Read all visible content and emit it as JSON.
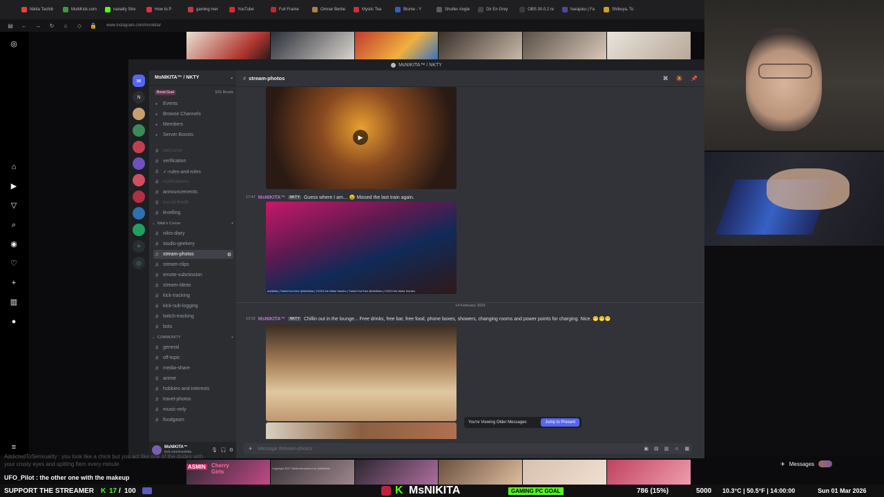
{
  "browser": {
    "tabs": [
      "Nikita Tachib",
      "MultiKick.com",
      "nanatty Stre",
      "How to P",
      "gaming mer",
      "YouTube",
      "Full Frame",
      "Omnar Berbe",
      "Mystic Tea",
      "Blume - Y",
      "Shutter Angle",
      "Dir En Grey",
      "OBS 30.0.2 re",
      "harajuku | Fa",
      "Shibuya, To"
    ],
    "url": "www.instagram.com/msnikita/"
  },
  "discord": {
    "window_title": "MsNIKITA™ / NKTY",
    "server_name": "MsNIKITA™ / NKTY",
    "boost_goal": "Boost Goal",
    "boost_count": "5/31 Boosts",
    "guild_top_label": "N",
    "menu": [
      {
        "label": "Events",
        "icon": "calendar-icon"
      },
      {
        "label": "Browse Channels",
        "icon": "browse-icon"
      },
      {
        "label": "Members",
        "icon": "members-icon"
      },
      {
        "label": "Server Boosts",
        "icon": "boost-icon"
      }
    ],
    "channels_top": [
      {
        "label": "welcome",
        "state": "muted"
      },
      {
        "label": "verification",
        "state": "normal"
      },
      {
        "label": "✓-rules-and-roles",
        "state": "normal"
      },
      {
        "label": "notifications",
        "state": "muted"
      },
      {
        "label": "announcements",
        "state": "normal"
      },
      {
        "label": "social-feeds",
        "state": "muted"
      },
      {
        "label": "levelling",
        "state": "normal"
      }
    ],
    "category_nikki": "Nikki's Corner",
    "channels_nikki": [
      {
        "label": "nikis-diary",
        "state": "normal"
      },
      {
        "label": "studio-geekery",
        "state": "normal"
      },
      {
        "label": "stream-photos",
        "state": "active"
      },
      {
        "label": "stream-clips",
        "state": "normal"
      },
      {
        "label": "emote-submission",
        "state": "normal"
      },
      {
        "label": "stream-ideas",
        "state": "normal"
      },
      {
        "label": "kick-tracking",
        "state": "normal"
      },
      {
        "label": "kick-sub-logging",
        "state": "normal"
      },
      {
        "label": "twitch-tracking",
        "state": "normal"
      },
      {
        "label": "bots",
        "state": "normal"
      }
    ],
    "category_community": "COMMUNITY",
    "channels_community": [
      {
        "label": "general",
        "state": "normal"
      },
      {
        "label": "off-topic",
        "state": "normal"
      },
      {
        "label": "media-share",
        "state": "normal"
      },
      {
        "label": "anime",
        "state": "normal"
      },
      {
        "label": "hobbies-and-interests",
        "state": "normal"
      },
      {
        "label": "travel-photos",
        "state": "normal"
      },
      {
        "label": "music-only",
        "state": "normal"
      },
      {
        "label": "foodgasm",
        "state": "normal"
      }
    ],
    "user_name": "MsNIKITA™",
    "user_sub": "kick.com/msnikita",
    "current_channel": "stream-photos",
    "messages": [
      {
        "time": "17:47",
        "user": "MsNIKITA™",
        "tag": "NKTY",
        "text": "Guess where I am… 😀 Missed the last train again."
      },
      {
        "time": "13:32",
        "user": "MsNIKITA™",
        "tag": "NKTY",
        "text": "Chillin out in the lounge... Free drinks, free bar, free food, phone boxes, showers, changing rooms and power points for charging. Nice. 😁😁😁"
      }
    ],
    "photo_caption": "msNikita | Twitch/YouTube @MsNikita | ©2023 Ms Nikita Tachibo | Twitch/YouTube @MsNikita | ©2023 Ms Nikita Tachibo",
    "date_divider": "14 February 2023",
    "older_notice": "You're Viewing Older Messages",
    "jump_label": "Jump to Present",
    "composer_placeholder": "Message #stream-photos"
  },
  "overlay": {
    "chat_line_1": "AddictedToSensuality : you look like a chick but you act like one of the dudes with your crusty eyes and spitting flem every minute",
    "chat_line_2": "UFO_Pilot : the other one with the makeup",
    "bottom_caption": "Copyright 2017 Nikita Alexandra Lee (MsNikita)",
    "cherry_label": "Cherry Girls",
    "asmin_label": "ASMIN",
    "messages_label": "Messages",
    "ticker": {
      "support": "SUPPORT THE STREAMER",
      "support_count": "17",
      "support_goal": "100",
      "brand": "MsNIKITA",
      "gaming_goal": "GAMING PC GOAL",
      "goal_value": "786 (15%)",
      "goal_target": "5000",
      "weather": "10.3°C | 50.5°F | 14:00:00",
      "date": "Sun 01 Mar 2026"
    }
  },
  "colors": {
    "discord_bg": "#313338",
    "accent": "#5865f2",
    "username": "#c46edf",
    "kick_green": "#53fc18"
  }
}
